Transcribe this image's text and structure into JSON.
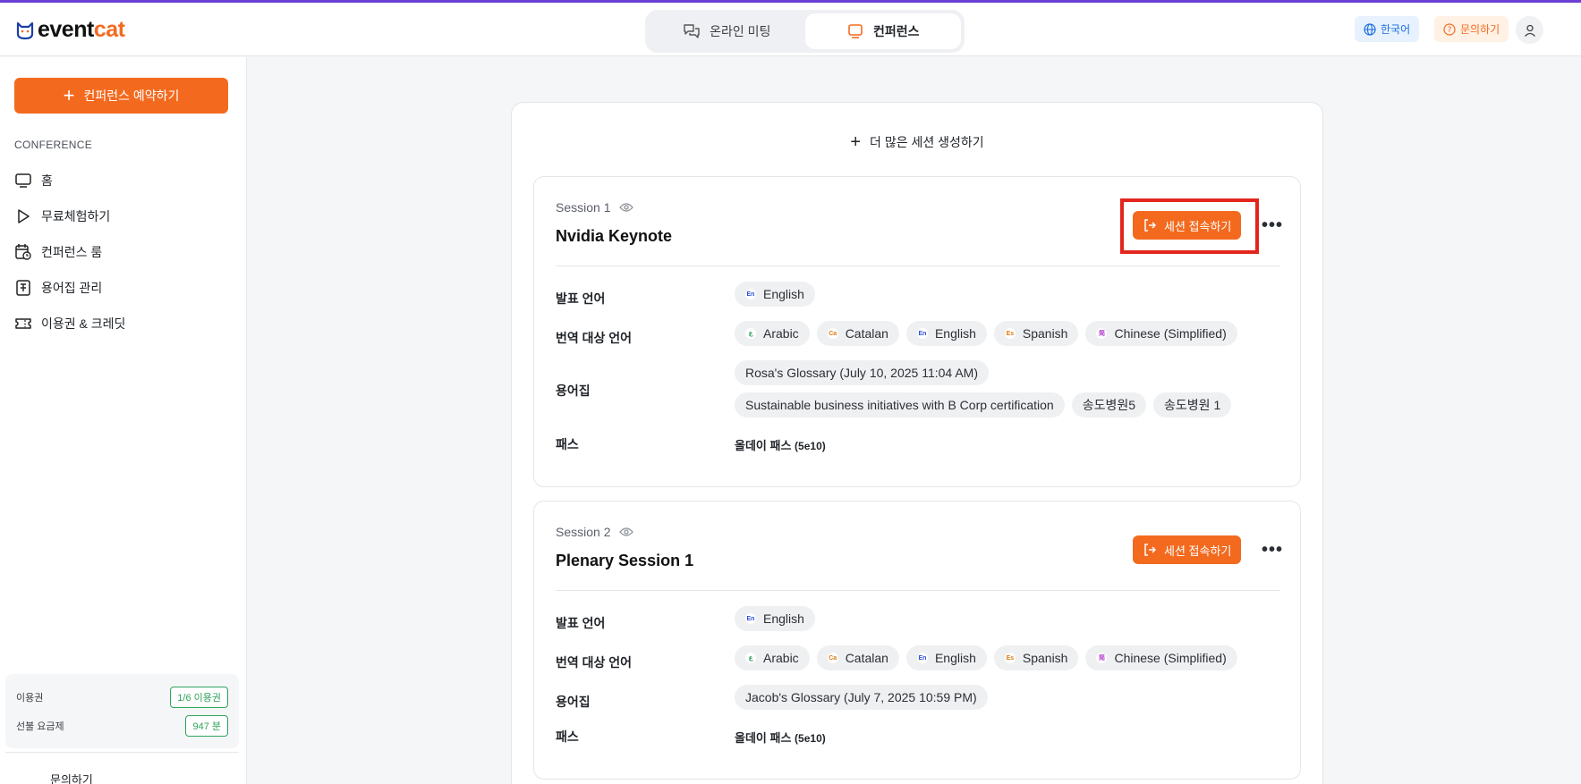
{
  "brand": {
    "name_a": "event",
    "name_b": "cat",
    "accent": "#f36a1f"
  },
  "header": {
    "tabs": [
      {
        "label": "온라인 미팅",
        "icon": "chat-bubbles-icon",
        "active": false
      },
      {
        "label": "컨퍼런스",
        "icon": "screen-icon",
        "active": true
      }
    ],
    "language": "한국어",
    "help": "문의하기"
  },
  "sidebar": {
    "book_button": "컨퍼런스 예약하기",
    "section": "CONFERENCE",
    "items": [
      {
        "label": "홈",
        "icon": "monitor-icon"
      },
      {
        "label": "무료체험하기",
        "icon": "play-icon"
      },
      {
        "label": "컨퍼런스 룸",
        "icon": "calendar-clock-icon"
      },
      {
        "label": "용어집 관리",
        "icon": "book-icon"
      },
      {
        "label": "이용권 & 크레딧",
        "icon": "ticket-icon"
      }
    ],
    "usage": {
      "pass_label": "이용권",
      "pass_value": "1/6 이용권",
      "prepaid_label": "선불 요금제",
      "prepaid_value": "947 분"
    },
    "help_link": "문의하기"
  },
  "main": {
    "more_sessions": "더 많은 세션 생성하기",
    "labels": {
      "speech_lang": "발표 언어",
      "target_lang": "번역 대상 언어",
      "glossary": "용어집",
      "pass": "패스",
      "join": "세션 접속하기"
    },
    "sessions": [
      {
        "label": "Session 1",
        "title": "Nvidia Keynote",
        "speech_lang": "English",
        "targets": [
          "Arabic",
          "Catalan",
          "English",
          "Spanish",
          "Chinese (Simplified)"
        ],
        "glossaries_row1": [
          "Rosa's Glossary (July 10, 2025 11:04 AM)"
        ],
        "glossaries_row2": [
          "Sustainable business initiatives with B Corp certification",
          "송도병원5",
          "송도병원 1"
        ],
        "pass_name": "올데이 패스",
        "pass_code": "(5e10)"
      },
      {
        "label": "Session 2",
        "title": "Plenary Session 1",
        "speech_lang": "English",
        "targets": [
          "Arabic",
          "Catalan",
          "English",
          "Spanish",
          "Chinese (Simplified)"
        ],
        "glossaries_row1": [
          "Jacob's Glossary (July 7, 2025 10:59 PM)"
        ],
        "pass_name": "올데이 패스",
        "pass_code": "(5e10)"
      }
    ]
  }
}
